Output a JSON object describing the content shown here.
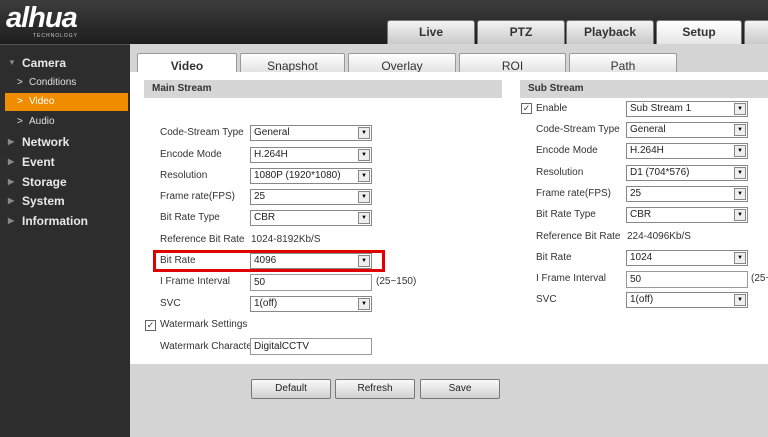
{
  "brand": {
    "logo": "alhua",
    "tagline": "TECHNOLOGY"
  },
  "top_tabs": [
    "Live",
    "PTZ",
    "Playback",
    "Setup"
  ],
  "sidebar": {
    "sections": [
      "Camera",
      "Network",
      "Event",
      "Storage",
      "System",
      "Information"
    ],
    "camera_items": [
      "Conditions",
      "Video",
      "Audio"
    ],
    "active_item": "Video"
  },
  "sub_tabs": [
    "Video",
    "Snapshot",
    "Overlay",
    "ROI",
    "Path"
  ],
  "main_stream": {
    "title": "Main Stream",
    "labels": {
      "code_stream_type": "Code-Stream Type",
      "encode_mode": "Encode Mode",
      "resolution": "Resolution",
      "frame_rate": "Frame rate(FPS)",
      "bit_rate_type": "Bit Rate Type",
      "reference_bit_rate": "Reference Bit Rate",
      "bit_rate": "Bit Rate",
      "i_frame_interval": "I Frame Interval",
      "svc": "SVC"
    },
    "values": {
      "code_stream_type": "General",
      "encode_mode": "H.264H",
      "resolution": "1080P (1920*1080)",
      "frame_rate": "25",
      "bit_rate_type": "CBR",
      "reference_bit_rate": "1024-8192Kb/S",
      "bit_rate": "4096",
      "i_frame_interval": "50",
      "i_frame_range": "(25~150)",
      "svc": "1(off)"
    },
    "watermark_label": "Watermark Settings",
    "watermark_character_label": "Watermark Character",
    "watermark_character": "DigitalCCTV"
  },
  "sub_stream": {
    "title": "Sub Stream",
    "enable_label": "Enable",
    "enable_value": "Sub Stream 1",
    "labels": {
      "code_stream_type": "Code-Stream Type",
      "encode_mode": "Encode Mode",
      "resolution": "Resolution",
      "frame_rate": "Frame rate(FPS)",
      "bit_rate_type": "Bit Rate Type",
      "reference_bit_rate": "Reference Bit Rate",
      "bit_rate": "Bit Rate",
      "i_frame_interval": "I Frame Interval",
      "svc": "SVC"
    },
    "values": {
      "code_stream_type": "General",
      "encode_mode": "H.264H",
      "resolution": "D1 (704*576)",
      "frame_rate": "25",
      "bit_rate_type": "CBR",
      "reference_bit_rate": "224-4096Kb/S",
      "bit_rate": "1024",
      "i_frame_interval": "50",
      "i_frame_range": "(25~",
      "svc": "1(off)"
    }
  },
  "buttons": {
    "default": "Default",
    "refresh": "Refresh",
    "save": "Save"
  },
  "colors": {
    "accent": "#f08c00",
    "highlight": "#e00000"
  }
}
